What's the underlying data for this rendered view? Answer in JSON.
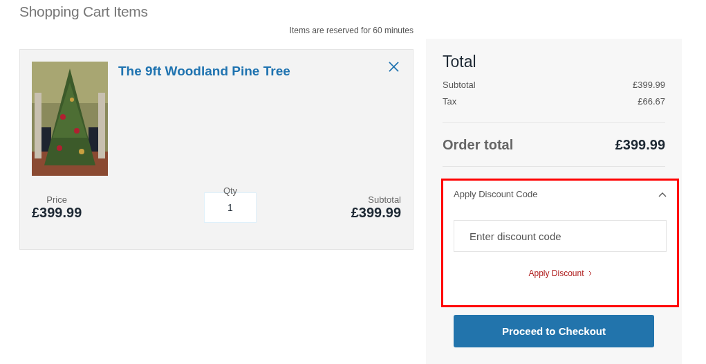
{
  "page_title": "Shopping Cart Items",
  "reservation_note": "Items are reserved for 60 minutes",
  "items": [
    {
      "name": "The 9ft Woodland Pine Tree",
      "price_label": "Price",
      "price": "£399.99",
      "qty_label": "Qty",
      "qty": "1",
      "subtotal_label": "Subtotal",
      "subtotal": "£399.99"
    }
  ],
  "summary": {
    "title": "Total",
    "lines": [
      {
        "label": "Subtotal",
        "value": "£399.99"
      },
      {
        "label": "Tax",
        "value": "£66.67"
      }
    ],
    "order_total_label": "Order total",
    "order_total": "£399.99"
  },
  "discount": {
    "title": "Apply Discount Code",
    "expanded": true,
    "highlighted": true,
    "placeholder": "Enter discount code",
    "apply_label": "Apply Discount"
  },
  "checkout_button": "Proceed to Checkout"
}
